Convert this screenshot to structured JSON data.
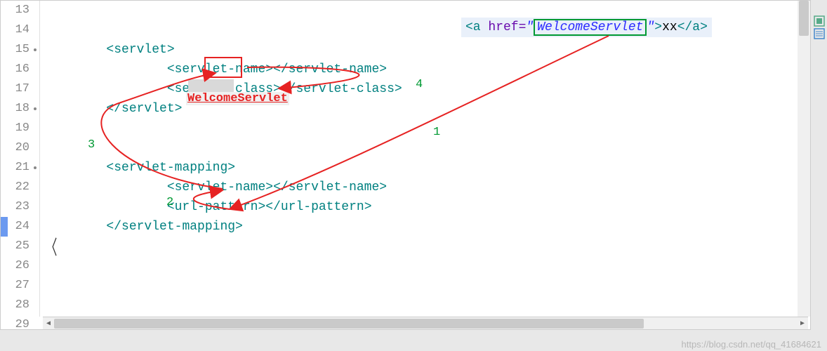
{
  "gutter": {
    "numbers": [
      "13",
      "14",
      "15",
      "16",
      "17",
      "18",
      "19",
      "20",
      "21",
      "22",
      "23",
      "24",
      "25",
      "26",
      "27",
      "28",
      "29"
    ]
  },
  "code": {
    "l15": {
      "open": "<servlet>",
      "indent": "        "
    },
    "l16": {
      "tag_open": "<servlet-name>",
      "tag_close": "</servlet-name>",
      "indent": "                "
    },
    "l17": {
      "tag_open": "<servlet-class>",
      "tag_close": "</servlet-class>",
      "indent": "                "
    },
    "l18": {
      "close": "</servlet>",
      "indent": "        "
    },
    "l21": {
      "tag": "<servlet-mapping>",
      "indent": "        "
    },
    "l22": {
      "tag_open": "<servlet-name>",
      "tag_close": "</servlet-name>",
      "indent": "                "
    },
    "l23": {
      "tag_open": "<url-pattern>",
      "tag_close": "</url-pattern>",
      "indent": "                "
    },
    "l24": {
      "tag": "</servlet-mapping>",
      "indent": "        "
    }
  },
  "snippet": {
    "open": "<a ",
    "attr": "href=",
    "quote1": "\"",
    "value": "WelcomeServlet",
    "quote2": "\"",
    "between": ">",
    "text": "xx",
    "close": "</a>"
  },
  "annotations": {
    "text": "WelcomeServlet",
    "num1": "1",
    "num2": "2",
    "num3": "3",
    "num4": "4"
  },
  "watermark": "https://blog.csdn.net/qq_41684621"
}
